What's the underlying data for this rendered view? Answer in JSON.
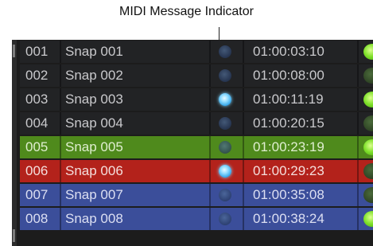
{
  "callout": {
    "label": "MIDI Message Indicator"
  },
  "rows": [
    {
      "number": "001",
      "name": "Snap 001",
      "timecode": "01:00:03:10",
      "midi_active": false,
      "led_on": true,
      "color": "#222325",
      "text_color": "#c9c9cc"
    },
    {
      "number": "002",
      "name": "Snap 002",
      "timecode": "01:00:08:00",
      "midi_active": false,
      "led_on": false,
      "color": "#222325",
      "text_color": "#c9c9cc"
    },
    {
      "number": "003",
      "name": "Snap 003",
      "timecode": "01:00:11:19",
      "midi_active": true,
      "led_on": true,
      "color": "#222325",
      "text_color": "#c9c9cc"
    },
    {
      "number": "004",
      "name": "Snap 004",
      "timecode": "01:00:20:15",
      "midi_active": false,
      "led_on": false,
      "color": "#222325",
      "text_color": "#c9c9cc"
    },
    {
      "number": "005",
      "name": "Snap 005",
      "timecode": "01:00:23:19",
      "midi_active": false,
      "led_on": true,
      "color": "#4f8a1c",
      "text_color": "#dfeed0"
    },
    {
      "number": "006",
      "name": "Snap 006",
      "timecode": "01:00:29:23",
      "midi_active": true,
      "led_on": false,
      "color": "#b3221b",
      "text_color": "#f4dedc"
    },
    {
      "number": "007",
      "name": "Snap 007",
      "timecode": "01:00:35:08",
      "midi_active": false,
      "led_on": false,
      "color": "#3b4e9a",
      "text_color": "#dcdff2"
    },
    {
      "number": "008",
      "name": "Snap 008",
      "timecode": "01:00:38:24",
      "midi_active": false,
      "led_on": true,
      "color": "#3b4e9a",
      "text_color": "#dcdff2"
    }
  ]
}
